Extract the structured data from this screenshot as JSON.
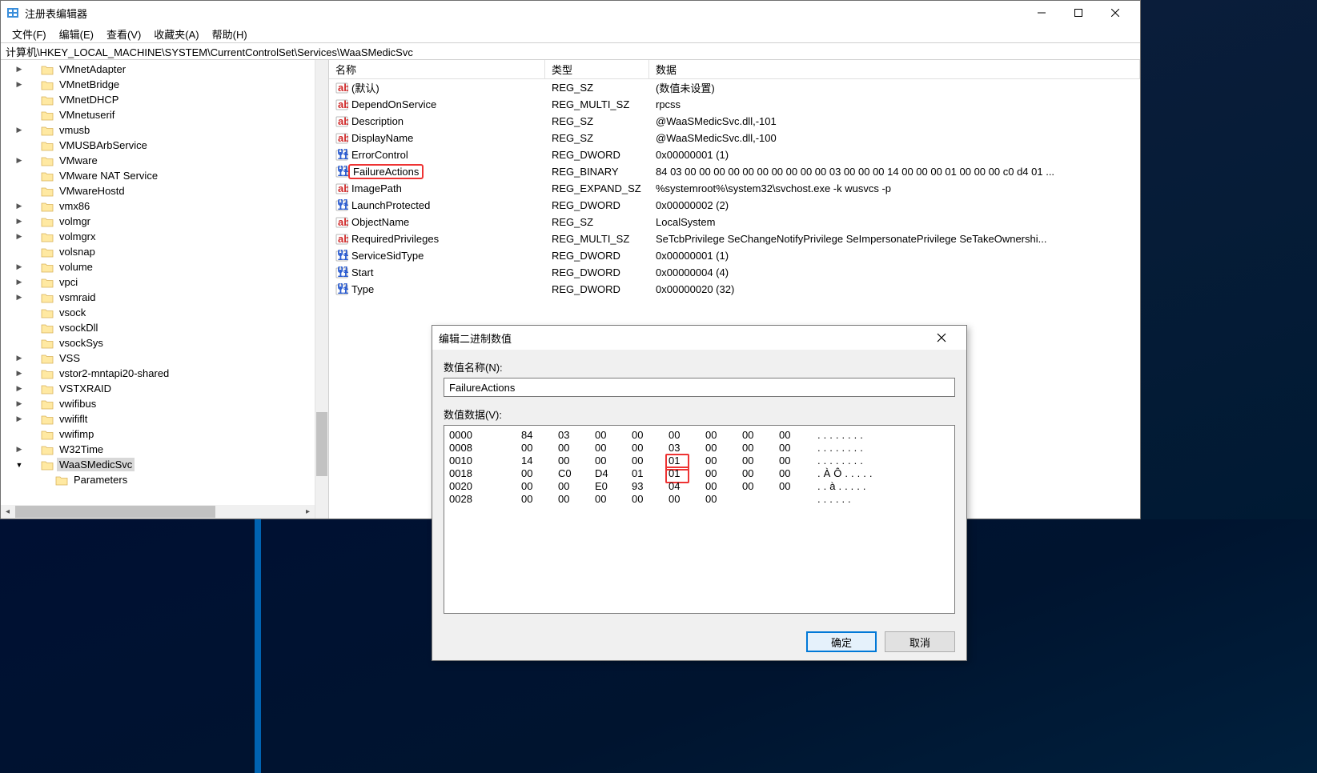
{
  "window": {
    "title": "注册表编辑器"
  },
  "menubar": {
    "file": "文件(F)",
    "edit": "编辑(E)",
    "view": "查看(V)",
    "favorites": "收藏夹(A)",
    "help": "帮助(H)"
  },
  "address": "计算机\\HKEY_LOCAL_MACHINE\\SYSTEM\\CurrentControlSet\\Services\\WaaSMedicSvc",
  "tree": [
    {
      "indent": 0,
      "expander": "right",
      "label": "VMnetAdapter"
    },
    {
      "indent": 0,
      "expander": "right",
      "label": "VMnetBridge"
    },
    {
      "indent": 0,
      "expander": "none",
      "label": "VMnetDHCP"
    },
    {
      "indent": 0,
      "expander": "none",
      "label": "VMnetuserif"
    },
    {
      "indent": 0,
      "expander": "right",
      "label": "vmusb"
    },
    {
      "indent": 0,
      "expander": "none",
      "label": "VMUSBArbService"
    },
    {
      "indent": 0,
      "expander": "right",
      "label": "VMware"
    },
    {
      "indent": 0,
      "expander": "none",
      "label": "VMware NAT Service"
    },
    {
      "indent": 0,
      "expander": "none",
      "label": "VMwareHostd"
    },
    {
      "indent": 0,
      "expander": "right",
      "label": "vmx86"
    },
    {
      "indent": 0,
      "expander": "right",
      "label": "volmgr"
    },
    {
      "indent": 0,
      "expander": "right",
      "label": "volmgrx"
    },
    {
      "indent": 0,
      "expander": "none",
      "label": "volsnap"
    },
    {
      "indent": 0,
      "expander": "right",
      "label": "volume"
    },
    {
      "indent": 0,
      "expander": "right",
      "label": "vpci"
    },
    {
      "indent": 0,
      "expander": "right",
      "label": "vsmraid"
    },
    {
      "indent": 0,
      "expander": "none",
      "label": "vsock"
    },
    {
      "indent": 0,
      "expander": "none",
      "label": "vsockDll"
    },
    {
      "indent": 0,
      "expander": "none",
      "label": "vsockSys"
    },
    {
      "indent": 0,
      "expander": "right",
      "label": "VSS"
    },
    {
      "indent": 0,
      "expander": "right",
      "label": "vstor2-mntapi20-shared"
    },
    {
      "indent": 0,
      "expander": "right",
      "label": "VSTXRAID"
    },
    {
      "indent": 0,
      "expander": "right",
      "label": "vwifibus"
    },
    {
      "indent": 0,
      "expander": "right",
      "label": "vwififlt"
    },
    {
      "indent": 0,
      "expander": "none",
      "label": "vwifimp"
    },
    {
      "indent": 0,
      "expander": "right",
      "label": "W32Time"
    },
    {
      "indent": 0,
      "expander": "down",
      "label": "WaaSMedicSvc",
      "selected": true
    },
    {
      "indent": 1,
      "expander": "none",
      "label": "Parameters"
    }
  ],
  "columns": {
    "name": "名称",
    "type": "类型",
    "data": "数据"
  },
  "values": [
    {
      "icon": "sz",
      "name": "(默认)",
      "type": "REG_SZ",
      "data": "(数值未设置)"
    },
    {
      "icon": "sz",
      "name": "DependOnService",
      "type": "REG_MULTI_SZ",
      "data": "rpcss"
    },
    {
      "icon": "sz",
      "name": "Description",
      "type": "REG_SZ",
      "data": "@WaaSMedicSvc.dll,-101"
    },
    {
      "icon": "sz",
      "name": "DisplayName",
      "type": "REG_SZ",
      "data": "@WaaSMedicSvc.dll,-100"
    },
    {
      "icon": "bin",
      "name": "ErrorControl",
      "type": "REG_DWORD",
      "data": "0x00000001 (1)"
    },
    {
      "icon": "bin",
      "name": "FailureActions",
      "type": "REG_BINARY",
      "data": "84 03 00 00 00 00 00 00 00 00 00 00 03 00 00 00 14 00 00 00 01 00 00 00 c0 d4 01 ...",
      "highlight": true
    },
    {
      "icon": "sz",
      "name": "ImagePath",
      "type": "REG_EXPAND_SZ",
      "data": "%systemroot%\\system32\\svchost.exe -k wusvcs -p"
    },
    {
      "icon": "bin",
      "name": "LaunchProtected",
      "type": "REG_DWORD",
      "data": "0x00000002 (2)"
    },
    {
      "icon": "sz",
      "name": "ObjectName",
      "type": "REG_SZ",
      "data": "LocalSystem"
    },
    {
      "icon": "sz",
      "name": "RequiredPrivileges",
      "type": "REG_MULTI_SZ",
      "data": "SeTcbPrivilege SeChangeNotifyPrivilege SeImpersonatePrivilege SeTakeOwnershi..."
    },
    {
      "icon": "bin",
      "name": "ServiceSidType",
      "type": "REG_DWORD",
      "data": "0x00000001 (1)"
    },
    {
      "icon": "bin",
      "name": "Start",
      "type": "REG_DWORD",
      "data": "0x00000004 (4)"
    },
    {
      "icon": "bin",
      "name": "Type",
      "type": "REG_DWORD",
      "data": "0x00000020 (32)"
    }
  ],
  "dialog": {
    "title": "编辑二进制数值",
    "name_label": "数值名称(N):",
    "name_value": "FailureActions",
    "data_label": "数值数据(V):",
    "ok": "确定",
    "cancel": "取消",
    "hex_rows": [
      {
        "off": "0000",
        "bytes": [
          "84",
          "03",
          "00",
          "00",
          "00",
          "00",
          "00",
          "00"
        ],
        "ascii": "........"
      },
      {
        "off": "0008",
        "bytes": [
          "00",
          "00",
          "00",
          "00",
          "03",
          "00",
          "00",
          "00"
        ],
        "ascii": "........"
      },
      {
        "off": "0010",
        "bytes": [
          "14",
          "00",
          "00",
          "00",
          "01",
          "00",
          "00",
          "00"
        ],
        "ascii": "........",
        "mark": 4
      },
      {
        "off": "0018",
        "bytes": [
          "00",
          "C0",
          "D4",
          "01",
          "01",
          "00",
          "00",
          "00"
        ],
        "ascii": ".ÀÔ.....",
        "mark": 4
      },
      {
        "off": "0020",
        "bytes": [
          "00",
          "00",
          "E0",
          "93",
          "04",
          "00",
          "00",
          "00"
        ],
        "ascii": "..à....."
      },
      {
        "off": "0028",
        "bytes": [
          "00",
          "00",
          "00",
          "00",
          "00",
          "00"
        ],
        "ascii": "......"
      }
    ]
  }
}
